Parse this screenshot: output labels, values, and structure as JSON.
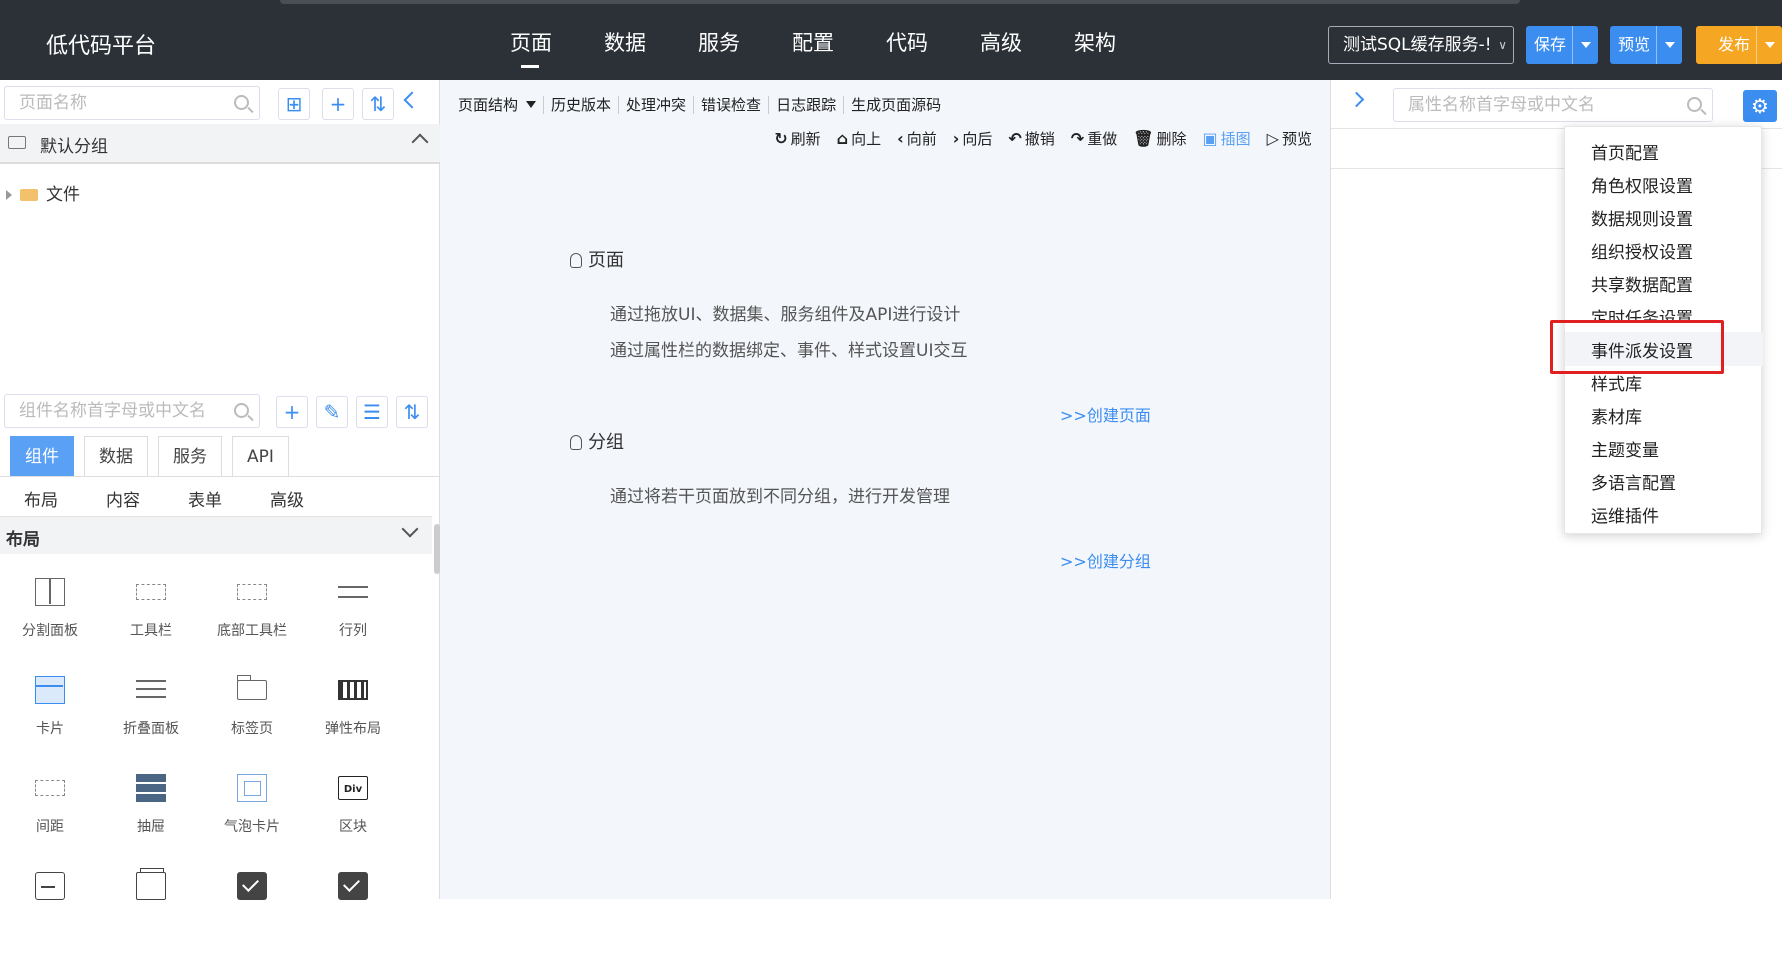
{
  "header": {
    "brand": "低代码平台",
    "nav": [
      "页面",
      "数据",
      "服务",
      "配置",
      "代码",
      "高级",
      "架构"
    ],
    "service_select": "测试SQL缓存服务-!",
    "save": "保存",
    "preview": "预览",
    "publish": "发布"
  },
  "left": {
    "page_search_placeholder": "页面名称",
    "group": "默认分组",
    "tree_item": "文件",
    "component_search_placeholder": "组件名称首字母或中文名",
    "tabs": [
      "组件",
      "数据",
      "服务",
      "API"
    ],
    "subtabs": [
      "布局",
      "内容",
      "表单",
      "高级"
    ],
    "category": "布局",
    "components": [
      "分割面板",
      "工具栏",
      "底部工具栏",
      "行列",
      "卡片",
      "折叠面板",
      "标签页",
      "弹性布局",
      "间距",
      "抽屉",
      "气泡卡片",
      "区块"
    ],
    "div_icon_text": "Div"
  },
  "center": {
    "menu1": [
      "页面结构",
      "历史版本",
      "处理冲突",
      "错误检查",
      "日志跟踪",
      "生成页面源码"
    ],
    "menu2": [
      {
        "glyph": "↻",
        "label": "刷新"
      },
      {
        "glyph": "⌂",
        "label": "向上"
      },
      {
        "glyph": "‹",
        "label": "向前"
      },
      {
        "glyph": "›",
        "label": "向后"
      },
      {
        "glyph": "↶",
        "label": "撤销"
      },
      {
        "glyph": "↷",
        "label": "重做"
      },
      {
        "glyph": "🗑",
        "label": "删除"
      },
      {
        "glyph": "▣",
        "label": "插图"
      },
      {
        "glyph": "▷",
        "label": "预览"
      }
    ],
    "page_title": "页面",
    "page_line1": "通过拖放UI、数据集、服务组件及API进行设计",
    "page_line2": "通过属性栏的数据绑定、事件、样式设置UI交互",
    "create_page": ">>创建页面",
    "group_title": "分组",
    "group_line1": "通过将若干页面放到不同分组，进行开发管理",
    "create_group": ">>创建分组"
  },
  "right": {
    "prop_search_placeholder": "属性名称首字母或中文名",
    "dropdown": [
      "首页配置",
      "角色权限设置",
      "数据规则设置",
      "组织授权设置",
      "共享数据配置",
      "定时任务设置",
      "事件派发设置",
      "样式库",
      "素材库",
      "主题变量",
      "多语言配置",
      "运维插件"
    ]
  },
  "colors": {
    "header_bg": "#2b3137",
    "primary": "#3b8df0",
    "publish": "#f5a623",
    "highlight_box": "#e02020"
  }
}
